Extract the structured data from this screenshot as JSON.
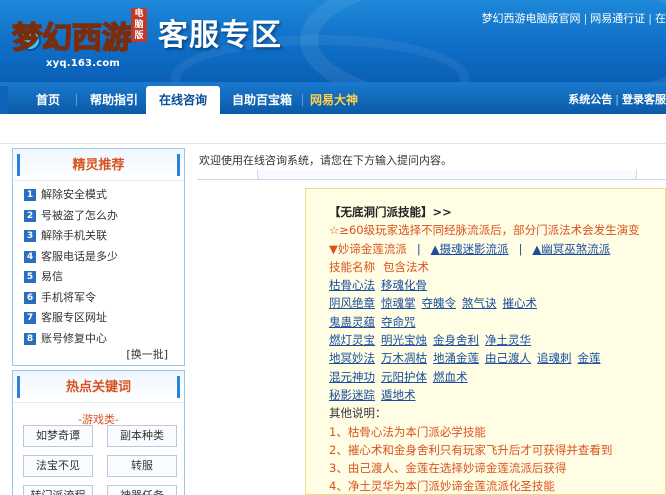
{
  "header": {
    "logo_text": "梦幻西游",
    "logo_sub": "xyq.163.com",
    "logo_badge": "电脑版",
    "site_title": "客服专区",
    "links": [
      "梦幻西游电脑版官网",
      "网易通行证",
      "在"
    ]
  },
  "nav": {
    "items": [
      "首页",
      "帮助指引",
      "在线咨询",
      "自助百宝箱",
      "网易大神"
    ],
    "active": "在线咨询",
    "right_links": [
      "系统公告",
      "登录客服"
    ]
  },
  "sidebar": {
    "recommend_title": "精灵推荐",
    "questions": [
      {
        "num": "1",
        "text": "解除安全模式"
      },
      {
        "num": "2",
        "text": "号被盗了怎么办"
      },
      {
        "num": "3",
        "text": "解除手机关联"
      },
      {
        "num": "4",
        "text": "客服电话是多少"
      },
      {
        "num": "5",
        "text": "易信"
      },
      {
        "num": "6",
        "text": "手机将军令"
      },
      {
        "num": "7",
        "text": "客服专区网址"
      },
      {
        "num": "8",
        "text": "账号修复中心"
      }
    ],
    "more_label": "[换一批]",
    "keywords_title": "热点关键词",
    "keyword_category": "-游戏类-",
    "keywords": [
      "如梦奇谭",
      "副本种类",
      "法宝不见",
      "转服",
      "转门派流程",
      "神器任务"
    ]
  },
  "main": {
    "welcome": "欢迎使用在线咨询系统，请您在下方输入提问内容。",
    "answer": {
      "title": "【无底洞门派技能】>>",
      "notice": "☆≥60级玩家选择不同经脉流派后，部分门派法术会发生演变",
      "schools": [
        "▼妙谛金莲流派",
        "▲摄魂迷影流派",
        "▲幽冥巫煞流派"
      ],
      "header_cols": [
        "技能名称",
        "包含法术"
      ],
      "rows": [
        [
          "枯骨心法",
          "移魂化骨"
        ],
        [
          "阴风绝章",
          "惊魂掌",
          "夺魄令",
          "煞气诀",
          "摧心术"
        ],
        [
          "鬼蛊灵蕴",
          "夺命咒"
        ],
        [
          "燃灯灵宝",
          "明光宝烛",
          "金身舍利",
          "净土灵华"
        ],
        [
          "地冥妙法",
          "万木凋枯",
          "地涌金莲",
          "由己渡人",
          "追魂刺",
          "金莲"
        ],
        [
          "混元神功",
          "元阳护体",
          "燃血术"
        ],
        [
          "秘影迷踪",
          "遁地术"
        ]
      ],
      "notes_title": "其他说明：",
      "notes": [
        "1、枯骨心法为本门派必学技能",
        "2、摧心术和金身舍利只有玩家飞升后才可获得并查看到",
        "3、由己渡人、金莲在选择妙谛金莲流派后获得",
        "4、净土灵华为本门派妙谛金莲流派化圣技能"
      ]
    }
  },
  "colors": {
    "header_blue": "#0f6fc8",
    "accent_orange": "#d9531e",
    "link_blue": "#1a4fa0",
    "answer_bg": "#fffde4"
  }
}
